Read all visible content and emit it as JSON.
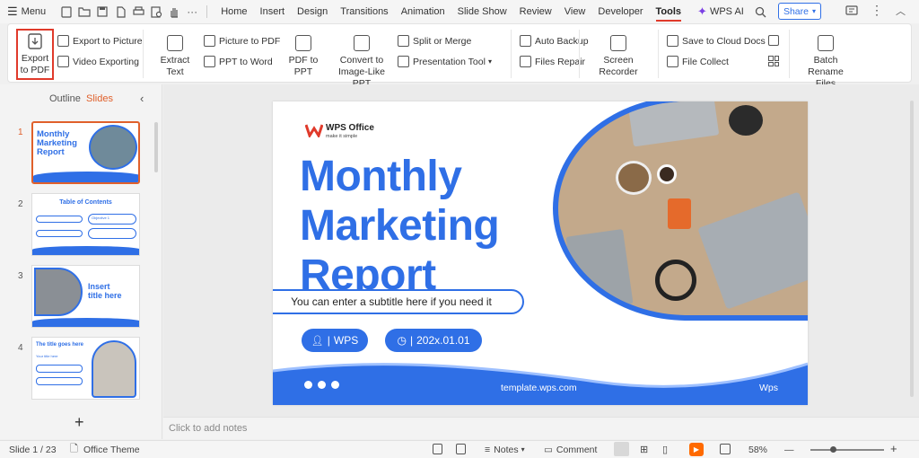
{
  "menubar": {
    "menu_label": "Menu",
    "tabs": [
      "Home",
      "Insert",
      "Design",
      "Transitions",
      "Animation",
      "Slide Show",
      "Review",
      "View",
      "Developer",
      "Tools"
    ],
    "active_tab": "Tools",
    "wps_ai": "WPS AI",
    "share": "Share"
  },
  "ribbon": {
    "export_pdf": [
      "Export",
      "to PDF"
    ],
    "export_picture": "Export to Picture",
    "video_exporting": "Video  Exporting",
    "extract_text": "Extract Text",
    "picture_to_pdf": "Picture to PDF",
    "ppt_to_word": "PPT to Word",
    "pdf_to_ppt": "PDF to PPT",
    "convert_image_ppt": [
      "Convert to",
      "Image-Like PPT"
    ],
    "split_merge": "Split or Merge",
    "presentation_tool": "Presentation Tool",
    "auto_backup": "Auto Backup",
    "files_repair": "Files Repair",
    "screen_recorder": "Screen Recorder",
    "save_cloud": "Save to  Cloud Docs",
    "file_collect": "File Collect",
    "batch_rename": [
      "Batch Rename",
      "Files"
    ]
  },
  "panel": {
    "tab_outline": "Outline",
    "tab_slides": "Slides",
    "slide_numbers": [
      "1",
      "2",
      "3",
      "4"
    ],
    "thumb1": {
      "title": [
        "Monthly",
        "Marketing",
        "Report"
      ]
    },
    "thumb2": {
      "title": "Table of Contents",
      "objective": "Objective 1"
    },
    "thumb3": {
      "title": [
        "Insert",
        "title here"
      ]
    },
    "thumb4": {
      "title": "The title goes here",
      "subtitle": "Your title here"
    }
  },
  "slide": {
    "brand": "WPS Office",
    "brand_tagline": "make it simple",
    "title": [
      "Monthly",
      "Marketing",
      "Report"
    ],
    "subtitle": "You can enter a subtitle here if you need it",
    "author": "WPS",
    "date": "202x.01.01",
    "site": "template.wps.com",
    "footer_brand": "Wps"
  },
  "notes_placeholder": "Click to add notes",
  "status": {
    "slide_info": "Slide 1 / 23",
    "theme": "Office Theme",
    "notes": "Notes",
    "comment": "Comment",
    "zoom": "58%"
  },
  "colors": {
    "accent_red": "#e03a2b",
    "slide_blue": "#2f6fe6",
    "play_orange": "#ff6a00"
  }
}
